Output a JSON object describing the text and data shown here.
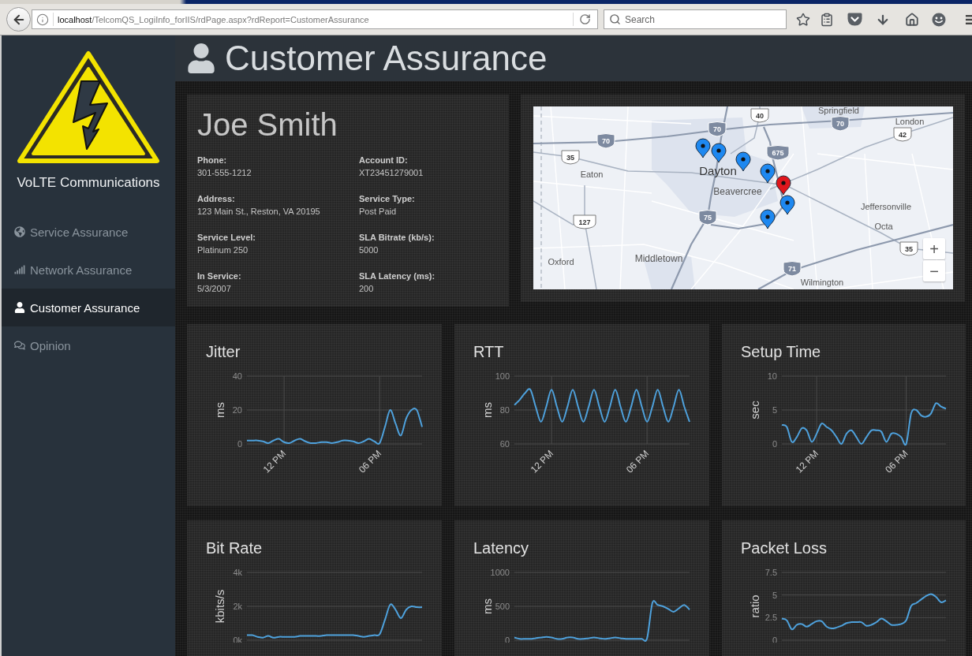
{
  "browser": {
    "address_bar": {
      "host": "localhost",
      "path": "/TelcomQS_LogiInfo_forIIS/rdPage.aspx?rdReport=CustomerAssurance"
    },
    "search": {
      "placeholder": "Search"
    }
  },
  "sidebar": {
    "brand": "VoLTE Communications",
    "items": [
      {
        "label": "Service Assurance",
        "selected": false
      },
      {
        "label": "Network Assurance",
        "selected": false
      },
      {
        "label": "Customer Assurance",
        "selected": true
      },
      {
        "label": "Opinion",
        "selected": false
      }
    ]
  },
  "header": {
    "title": "Customer Assurance"
  },
  "customer": {
    "name": "Joe Smith",
    "fields": [
      {
        "label": "Phone:",
        "value": "301-555-1212"
      },
      {
        "label": "Account ID:",
        "value": "XT23451279001"
      },
      {
        "label": "Address:",
        "value": "123 Main St., Reston, VA 20195"
      },
      {
        "label": "Service Type:",
        "value": "Post Paid"
      },
      {
        "label": "Service Level:",
        "value": "Platinum 250"
      },
      {
        "label": "SLA Bitrate (kb/s):",
        "value": "5000"
      },
      {
        "label": "In Service:",
        "value": "5/3/2007"
      },
      {
        "label": "SLA Latency (ms):",
        "value": "200"
      }
    ]
  },
  "map": {
    "places": [
      "Springfield",
      "London",
      "Dayton",
      "Eaton",
      "Beavercree",
      "Jeffersonville",
      "Octa",
      "Middletown",
      "Oxford",
      "Wilmington"
    ],
    "shields": [
      {
        "kind": "us",
        "number": "40"
      },
      {
        "kind": "interstate",
        "number": "70"
      },
      {
        "kind": "interstate",
        "number": "70"
      },
      {
        "kind": "us",
        "number": "42"
      },
      {
        "kind": "interstate",
        "number": "70"
      },
      {
        "kind": "us",
        "number": "35"
      },
      {
        "kind": "interstate",
        "number": "675"
      },
      {
        "kind": "interstate",
        "number": "75"
      },
      {
        "kind": "us",
        "number": "127"
      },
      {
        "kind": "us",
        "number": "35"
      },
      {
        "kind": "interstate",
        "number": "71"
      }
    ],
    "pins": [
      {
        "color": "#1e88f0"
      },
      {
        "color": "#1e88f0"
      },
      {
        "color": "#1e88f0"
      },
      {
        "color": "#1e88f0"
      },
      {
        "color": "#e0161c"
      },
      {
        "color": "#1e88f0"
      },
      {
        "color": "#1e88f0"
      }
    ],
    "zoom_in": "+",
    "zoom_out": "−"
  },
  "charts": [
    {
      "chart_data": {
        "type": "line",
        "title": "Jitter",
        "ylabel": "ms",
        "grid": true,
        "categories": [
          null,
          null,
          null,
          null,
          null,
          null,
          null,
          "12 PM",
          null,
          null,
          null,
          null,
          null,
          null,
          null,
          null,
          null,
          null,
          null,
          null,
          null,
          null,
          null,
          null,
          null,
          "06 PM",
          null,
          null,
          null,
          null,
          null,
          null,
          null,
          null
        ],
        "series": [
          {
            "color": "#4ea1dc",
            "values": [
              2,
              2,
              2,
              1.5,
              0.5,
              2,
              3,
              1,
              0.5,
              2,
              3,
              1.5,
              0.5,
              0.5,
              1,
              1,
              0.5,
              1,
              2,
              2,
              1.5,
              0.5,
              1.5,
              3,
              1.5,
              0.5,
              10,
              20,
              12,
              5,
              15,
              20,
              20,
              10
            ]
          }
        ],
        "ylim": [
          0,
          40
        ],
        "yticks": [
          0,
          20,
          40
        ]
      }
    },
    {
      "chart_data": {
        "type": "line",
        "title": "RTT",
        "ylabel": "ms",
        "grid": true,
        "categories": [
          null,
          null,
          null,
          null,
          null,
          null,
          null,
          "12 PM",
          null,
          null,
          null,
          null,
          null,
          null,
          null,
          null,
          null,
          null,
          null,
          null,
          null,
          null,
          null,
          null,
          null,
          "06 PM",
          null,
          null,
          null,
          null,
          null,
          null,
          null,
          null
        ],
        "series": [
          {
            "color": "#4ea1dc",
            "values": [
              83,
              86,
              90,
              92,
              82,
              73,
              82,
              92,
              82,
              73,
              82,
              92,
              82,
              73,
              82,
              92,
              82,
              73,
              82,
              92,
              82,
              73,
              82,
              92,
              82,
              73,
              82,
              92,
              82,
              73,
              82,
              92,
              82,
              73
            ]
          }
        ],
        "ylim": [
          60,
          100
        ],
        "yticks": [
          60,
          80,
          100
        ]
      }
    },
    {
      "chart_data": {
        "type": "line",
        "title": "Setup Time",
        "ylabel": "sec",
        "grid": true,
        "categories": [
          null,
          null,
          null,
          null,
          null,
          null,
          null,
          "12 PM",
          null,
          null,
          null,
          null,
          null,
          null,
          null,
          null,
          null,
          null,
          null,
          null,
          null,
          null,
          null,
          null,
          null,
          "06 PM",
          null,
          null,
          null,
          null,
          null,
          null,
          null,
          null
        ],
        "series": [
          {
            "color": "#4ea1dc",
            "values": [
              2.8,
              2.5,
              0.3,
              1,
              2.3,
              2,
              0.3,
              1.5,
              3,
              2.5,
              2,
              1,
              0,
              1.5,
              2,
              1,
              0,
              1,
              2,
              2,
              1.8,
              0.3,
              1.5,
              1.5,
              1,
              0,
              4.5,
              5,
              4.2,
              4,
              4.5,
              6,
              5.5,
              5.2
            ]
          }
        ],
        "ylim": [
          0,
          10
        ],
        "yticks": [
          0,
          5,
          10
        ]
      }
    },
    {
      "chart_data": {
        "type": "line",
        "title": "Bit Rate",
        "ylabel": "kbits/s",
        "grid": true,
        "categories": [
          null,
          null,
          null,
          null,
          null,
          null,
          null,
          null,
          null,
          null,
          null,
          null,
          null,
          null,
          null,
          null,
          null,
          null,
          null,
          null,
          null,
          null,
          null,
          null,
          null,
          null,
          null,
          null,
          null,
          null,
          null,
          null,
          null,
          null
        ],
        "series": [
          {
            "color": "#4ea1dc",
            "values": [
              300,
              300,
              200,
              150,
              250,
              150,
              200,
              200,
              200,
              200,
              250,
              250,
              250,
              250,
              250,
              300,
              300,
              300,
              300,
              300,
              300,
              250,
              200,
              250,
              300,
              350,
              1200,
              2100,
              1800,
              1300,
              1800,
              2000,
              1950,
              1950
            ]
          }
        ],
        "ylim": [
          0,
          4000
        ],
        "yticks": [
          {
            "value": 0,
            "label": "0k"
          },
          {
            "value": 2000,
            "label": "2k"
          },
          {
            "value": 4000,
            "label": "4k"
          }
        ]
      }
    },
    {
      "chart_data": {
        "type": "line",
        "title": "Latency",
        "ylabel": "ms",
        "grid": true,
        "categories": [
          null,
          null,
          null,
          null,
          null,
          null,
          null,
          null,
          null,
          null,
          null,
          null,
          null,
          null,
          null,
          null,
          null,
          null,
          null,
          null,
          null,
          null,
          null,
          null,
          null,
          null,
          null,
          null,
          null,
          null,
          null,
          null,
          null,
          null
        ],
        "series": [
          {
            "color": "#4ea1dc",
            "values": [
              40,
              20,
              20,
              20,
              30,
              40,
              50,
              40,
              20,
              20,
              40,
              40,
              20,
              20,
              30,
              40,
              30,
              20,
              30,
              40,
              30,
              20,
              20,
              20,
              20,
              30,
              550,
              520,
              500,
              460,
              420,
              470,
              520,
              450
            ]
          }
        ],
        "ylim": [
          0,
          1000
        ],
        "yticks": [
          0,
          500,
          1000
        ]
      }
    },
    {
      "chart_data": {
        "type": "line",
        "title": "Packet Loss",
        "ylabel": "ratio",
        "grid": true,
        "categories": [
          null,
          null,
          null,
          null,
          null,
          null,
          null,
          null,
          null,
          null,
          null,
          null,
          null,
          null,
          null,
          null,
          null,
          null,
          null,
          null,
          null,
          null,
          null,
          null,
          null,
          null,
          null,
          null,
          null,
          null,
          null,
          null,
          null,
          null
        ],
        "series": [
          {
            "color": "#4ea1dc",
            "values": [
              2.4,
              2.2,
              1.2,
              1.7,
              1.8,
              1.5,
              1.8,
              2.1,
              2.1,
              1.5,
              1.3,
              1.4,
              1.6,
              1.9,
              2,
              2,
              2,
              1.6,
              1.7,
              2,
              2.4,
              2.1,
              1.7,
              1.7,
              1.8,
              2.2,
              3.8,
              4.1,
              4.5,
              4.9,
              5.1,
              4.8,
              4.2,
              4.4
            ]
          }
        ],
        "ylim": [
          0,
          7.5
        ],
        "yticks": [
          0,
          2.5,
          5,
          7.5
        ]
      }
    }
  ]
}
